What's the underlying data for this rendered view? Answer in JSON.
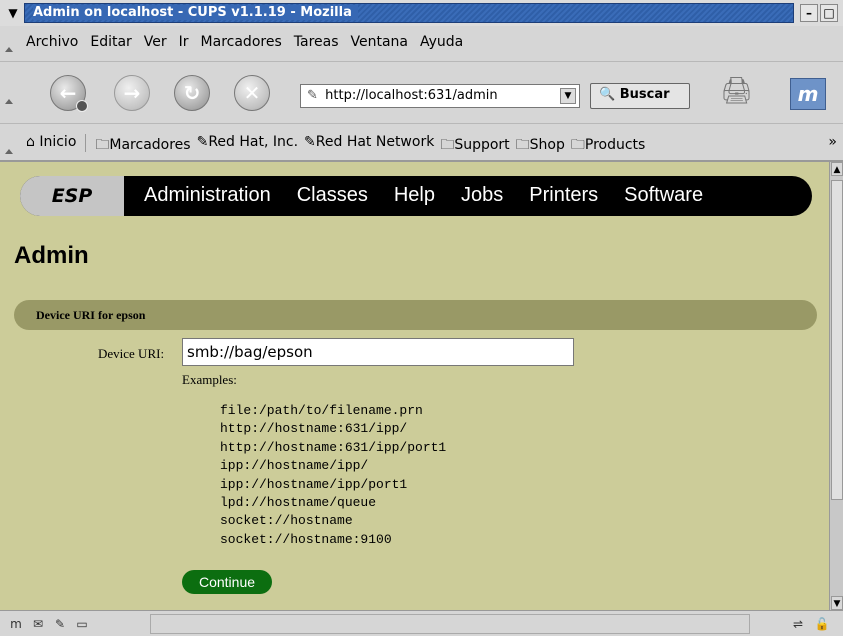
{
  "window": {
    "title": "Admin on localhost - CUPS v1.1.19 - Mozilla"
  },
  "menubar": [
    "Archivo",
    "Editar",
    "Ver",
    "Ir",
    "Marcadores",
    "Tareas",
    "Ventana",
    "Ayuda"
  ],
  "navbar": {
    "url": "http://localhost:631/admin",
    "search_label": "Buscar"
  },
  "personalbar": {
    "home_label": "Inicio",
    "items": [
      "Marcadores",
      "Red Hat, Inc.",
      "Red Hat Network",
      "Support",
      "Shop",
      "Products"
    ],
    "more": "»"
  },
  "cups_nav": {
    "brand": "ESP",
    "links": [
      "Administration",
      "Classes",
      "Help",
      "Jobs",
      "Printers",
      "Software"
    ]
  },
  "page": {
    "title": "Admin",
    "section_header": "Device URI for epson",
    "uri_label": "Device URI:",
    "uri_value": "smb://bag/epson",
    "examples_label": "Examples:",
    "examples": [
      "file:/path/to/filename.prn",
      "http://hostname:631/ipp/",
      "http://hostname:631/ipp/port1",
      "ipp://hostname/ipp/",
      "ipp://hostname/ipp/port1",
      "lpd://hostname/queue",
      "socket://hostname",
      "socket://hostname:9100"
    ],
    "continue_label": "Continue"
  },
  "colors": {
    "page_bg": "#cccc99",
    "section_bar": "#999966",
    "continue": "#0c6e10",
    "title_bar": "#3768b4"
  }
}
